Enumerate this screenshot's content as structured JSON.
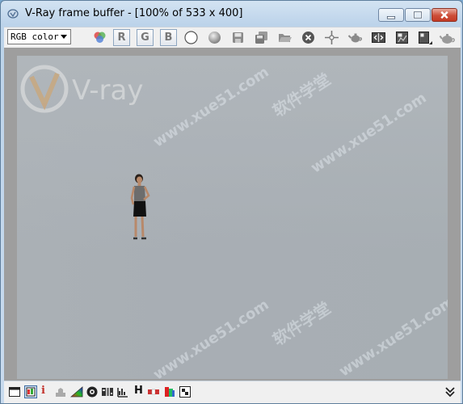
{
  "window": {
    "title": "V-Ray frame buffer - [100% of 533 x 400]"
  },
  "toolbar": {
    "channel_select": "RGB color",
    "channel_buttons": [
      "R",
      "G",
      "B"
    ]
  },
  "viewport": {
    "render_image": {
      "logo_text": "V-ray"
    },
    "watermarks": [
      "软件学堂",
      "www.xue51.com"
    ]
  },
  "statusbar": {
    "info_glyph": "i",
    "h_glyph": "H"
  },
  "colors": {
    "title_bar": "#c9dbee",
    "toolbar_bg": "#f0f0f0",
    "viewport_bg": "#9e9e9e",
    "render_bg": "#a9afb4",
    "close_button": "#c9452f"
  }
}
